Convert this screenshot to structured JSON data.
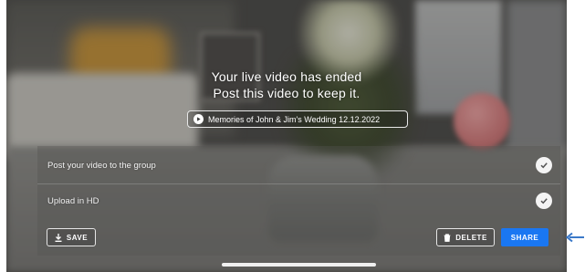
{
  "post_live": {
    "ended_title": "Your live video has ended",
    "ended_subtitle": "Post this video to keep it.",
    "video_title": "Memories of John & Jim's Wedding 12.12.2022"
  },
  "options": [
    {
      "label": "Post your video to the group",
      "checked": true
    },
    {
      "label": "Upload in HD",
      "checked": true
    }
  ],
  "actions": {
    "save_label": "SAVE",
    "delete_label": "DELETE",
    "share_label": "SHARE"
  },
  "icons": {
    "video_title": "play-circle-icon",
    "save": "download-icon",
    "delete": "trash-icon",
    "option_check": "check-circle-icon",
    "annotation": "arrow-left-icon"
  },
  "colors": {
    "share_button": "#1a77f2",
    "annotation_arrow": "#3b79c9"
  }
}
